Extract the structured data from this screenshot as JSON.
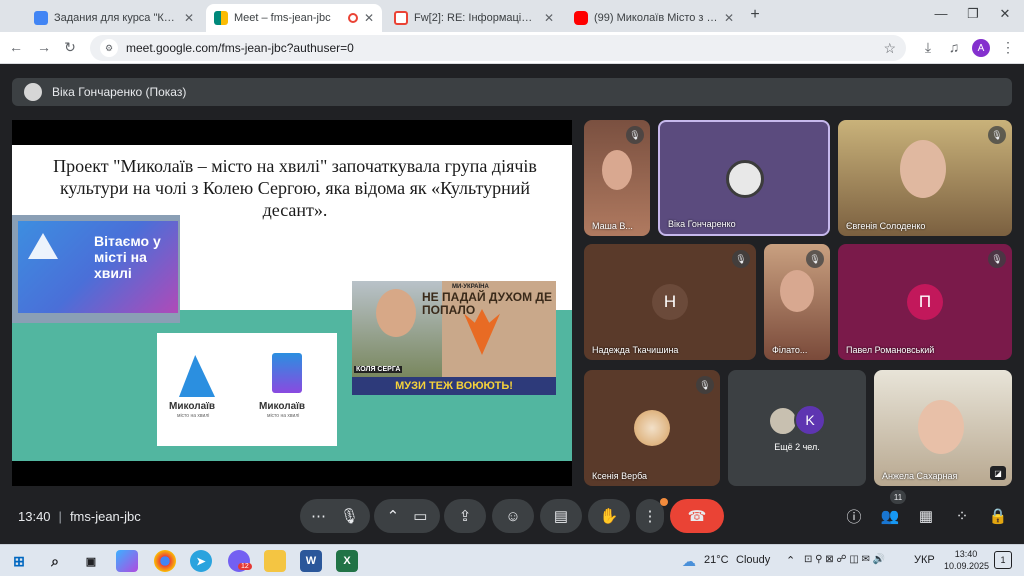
{
  "browser": {
    "tabs": [
      {
        "title": "Задания для курса \"КК-31 Вих",
        "favicon_color": "#4285f4",
        "active": false
      },
      {
        "title": "Meet – fms-jean-jbc",
        "favicon_color": "#00897b",
        "active": true
      },
      {
        "title": "Fw[2]: RE: Інформація щодо ко",
        "favicon_color": "#ea4335",
        "active": false
      },
      {
        "title": "(99) Миколаїв Місто з історією",
        "favicon_color": "#ff0000",
        "active": false
      }
    ],
    "new_tab_symbol": "+",
    "close_symbol": "✕",
    "window_controls": {
      "minimize": "—",
      "restore": "❐",
      "close": "✕"
    },
    "url": "meet.google.com/fms-jean-jbc?authuser=0",
    "profile_initial": "A",
    "accent": "#1a73e8"
  },
  "meet": {
    "presenter_label": "Віка Гончаренко (Показ)",
    "slide": {
      "text": "Проект \"Миколаїв – місто на хвилі\" започаткувала група діячів культури на чолі з Колею Сергою, яка відома як «Культурний десант».",
      "billboard_text": "Вітаємо у місті на хвилі",
      "logo1_name": "Миколаїв",
      "logo1_sub": "місто на хвилі",
      "logo2_name": "Миколаїв",
      "logo2_sub": "місто на хвилі",
      "poster_top": "МИ-УКРАЇНА",
      "poster_wall": "НЕ ПАДАЙ ДУХОМ ДЕ ПОПАЛО",
      "poster_name": "КОЛЯ СЕРГА",
      "poster_slogan": "МУЗИ ТЕЖ ВОЮЮТЬ!"
    },
    "participants": [
      {
        "name": "Маша В...",
        "muted": true,
        "type": "video"
      },
      {
        "name": "Віка Гончаренко",
        "muted": false,
        "type": "avatar-highlight"
      },
      {
        "name": "Євгенія Солоденко",
        "muted": true,
        "type": "video"
      },
      {
        "name": "Надежда Ткачишина",
        "muted": true,
        "type": "letter",
        "initial": "Н",
        "color": "#5f4a3f"
      },
      {
        "name": "Філато...",
        "muted": true,
        "type": "video"
      },
      {
        "name": "Павел Романовський",
        "muted": true,
        "type": "letter",
        "initial": "П",
        "color": "#c2185b"
      },
      {
        "name": "Ксенія Верба",
        "muted": true,
        "type": "avatar"
      },
      {
        "name": "Ещё 2 чел.",
        "muted": false,
        "type": "group",
        "initial": "K",
        "color": "#5e35b1"
      },
      {
        "name": "Анжела Сахарная",
        "muted": false,
        "type": "video"
      }
    ],
    "controls": {
      "time": "13:40",
      "separator": "|",
      "meeting_code": "fms-jean-jbc",
      "people_count": "11",
      "end_call_color": "#ea4335"
    }
  },
  "taskbar": {
    "weather_temp": "21°C",
    "weather_text": "Cloudy",
    "language": "УКР",
    "time": "13:40",
    "date": "10.09.2025",
    "viber_badge": "12",
    "notification_count": "1"
  }
}
